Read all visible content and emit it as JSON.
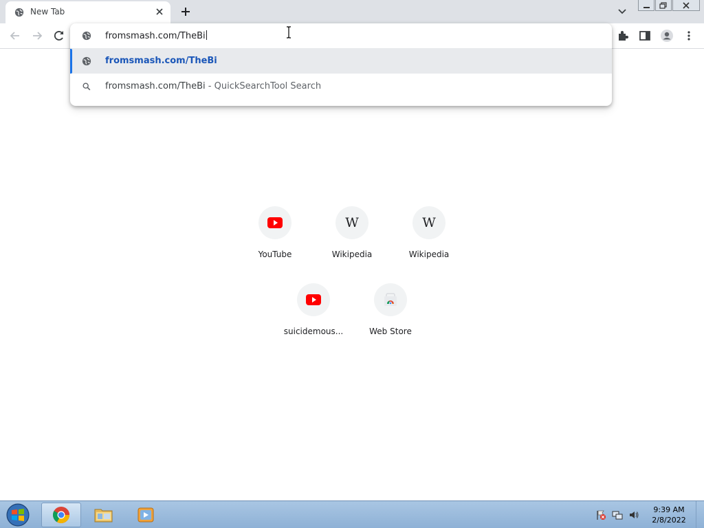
{
  "tab": {
    "title": "New Tab",
    "favicon": "globe-icon"
  },
  "omnibox": {
    "typed_text": "fromsmash.com/TheBi"
  },
  "suggestions": [
    {
      "text": "fromsmash.com/TheBi",
      "icon": "globe-icon",
      "selected": true
    },
    {
      "text": "fromsmash.com/TheBi",
      "description": " - QuickSearchTool Search",
      "icon": "search-icon",
      "selected": false
    }
  ],
  "shortcuts": [
    {
      "label": "YouTube",
      "icon": "youtube-icon"
    },
    {
      "label": "Wikipedia",
      "icon": "wikipedia-icon"
    },
    {
      "label": "Wikipedia",
      "icon": "wikipedia-icon"
    },
    {
      "label": "suicidemous...",
      "icon": "youtube-icon"
    },
    {
      "label": "Web Store",
      "icon": "chrome-web-store-icon"
    }
  ],
  "taskbar": {
    "items": [
      "chrome-icon",
      "windows-explorer-icon",
      "media-player-icon"
    ],
    "time": "9:39 AM",
    "date": "2/8/2022"
  },
  "colors": {
    "accent": "#1a73e8",
    "link_bold": "#1a56b8",
    "youtube_red": "#ff0000",
    "tabstrip": "#dee1e6"
  }
}
